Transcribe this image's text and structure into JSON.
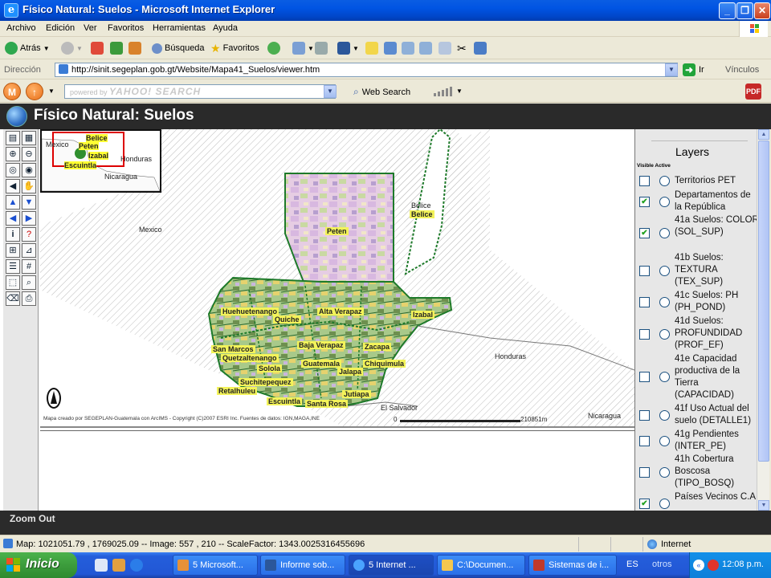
{
  "window": {
    "title": "Físico Natural: Suelos - Microsoft Internet Explorer",
    "app_icon": "ie-icon"
  },
  "menu": [
    "Archivo",
    "Edición",
    "Ver",
    "Favoritos",
    "Herramientas",
    "Ayuda"
  ],
  "toolbar": {
    "back_label": "Atrás",
    "search_label": "Búsqueda",
    "favorites_label": "Favoritos"
  },
  "address": {
    "label": "Dirección",
    "url": "http://sinit.segeplan.gob.gt/Website/Mapa41_Suelos/viewer.htm",
    "go_label": "Ir",
    "links_label": "Vínculos"
  },
  "yahoo": {
    "search_placeholder_small": "powered by",
    "search_placeholder_brand": "YAHOO! SEARCH",
    "web_search_label": "Web Search"
  },
  "app": {
    "title": "Físico Natural: Suelos"
  },
  "overview": {
    "labels": [
      "Mexico",
      "Belice",
      "Peten",
      "Izabal",
      "Honduras",
      "Escuintla",
      "Nicaragua"
    ]
  },
  "map": {
    "country_labels": {
      "mexico": "Mexico",
      "belice": "Belice",
      "honduras": "Honduras",
      "el_salvador": "El Salvador",
      "nicaragua": "Nicaragua"
    },
    "departments": [
      "Belice",
      "Peten",
      "Huehuetenango",
      "Alta Verapaz",
      "Izabal",
      "Quiche",
      "San Marcos",
      "Baja Verapaz",
      "Zacapa",
      "Quetzaltenango",
      "Guatemala",
      "Chiquimula",
      "Solola",
      "Jalapa",
      "Suchitepequez",
      "Retalhuleu",
      "Jutiapa",
      "Escuintla",
      "Santa Rosa"
    ],
    "credit": "Mapa creado por SEGEPLAN-Guatemala con ArcIMS - Copyright (C)2007 ESRI Inc. Fuentes de datos: IGN,MAGA,INE",
    "scale_start": "0",
    "scale_end": "210851m"
  },
  "layers": {
    "title": "Layers",
    "header": "Visible Active",
    "items": [
      {
        "name": "Territorios PET",
        "visible": false
      },
      {
        "name": "Departamentos de la República",
        "visible": true
      },
      {
        "name": "41a Suelos: COLOR (SOL_SUP)",
        "visible": true
      },
      {
        "name": "41b Suelos: TEXTURA (TEX_SUP)",
        "visible": false
      },
      {
        "name": "41c Suelos: PH (PH_POND)",
        "visible": false
      },
      {
        "name": "41d Suelos: PROFUNDIDAD (PROF_EF)",
        "visible": false
      },
      {
        "name": "41e Capacidad productiva de la Tierra (CAPACIDAD)",
        "visible": false
      },
      {
        "name": "41f Uso Actual del suelo (DETALLE1)",
        "visible": false
      },
      {
        "name": "41g Pendientes (INTER_PE)",
        "visible": false
      },
      {
        "name": "41h Cobertura Boscosa (TIPO_BOSQ)",
        "visible": false
      },
      {
        "name": "Países Vecinos C.A.",
        "visible": true
      }
    ]
  },
  "mode_label": "Zoom Out",
  "status": {
    "text": "Map: 1021051.79 , 1769025.09 -- Image: 557 , 210 -- ScaleFactor: 1343.0025316455696",
    "zone": "Internet"
  },
  "taskbar": {
    "start_label": "Inicio",
    "tasks": [
      "5 Microsoft...",
      "Informe sob...",
      "5 Internet ...",
      "C:\\Documen...",
      "Sistemas de i..."
    ],
    "language": "ES",
    "others": "otros",
    "clock": "12:08 p.m."
  },
  "colors": {
    "title_bar": "#0054e3",
    "app_header": "#2a2a2a",
    "dept_label_bg": "#f3f35a",
    "dept_border": "#1e7a2a",
    "start_button": "#3c9c3c"
  }
}
